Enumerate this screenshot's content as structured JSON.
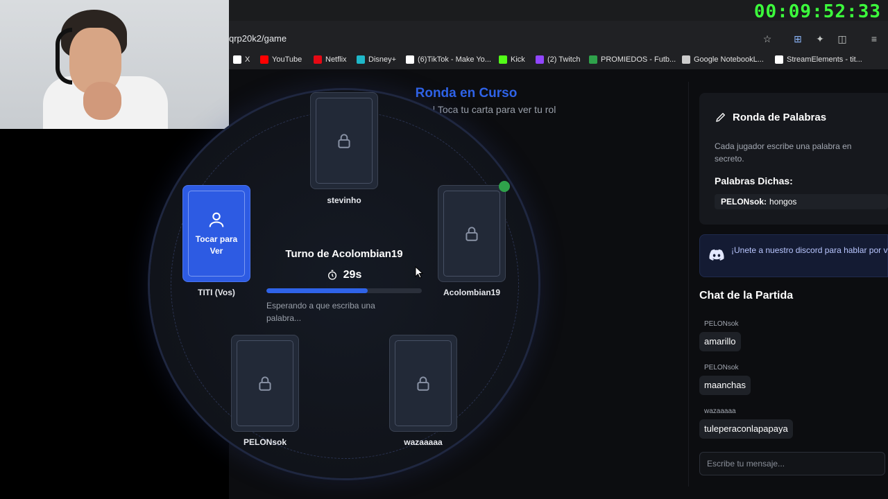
{
  "browser": {
    "url": "qrp20k2/game",
    "bookmarks": [
      {
        "label": "X",
        "icon": "x-icon",
        "color": "#ffffff"
      },
      {
        "label": "YouTube",
        "icon": "youtube-icon",
        "color": "#ff0000"
      },
      {
        "label": "Netflix",
        "icon": "netflix-icon",
        "color": "#e50914"
      },
      {
        "label": "Disney+",
        "icon": "disney-icon",
        "color": "#1fb8c9"
      },
      {
        "label": "(6)TikTok - Make Yo...",
        "icon": "tiktok-icon",
        "color": "#ffffff"
      },
      {
        "label": "Kick",
        "icon": "kick-icon",
        "color": "#53fc18"
      },
      {
        "label": "(2) Twitch",
        "icon": "twitch-icon",
        "color": "#9146ff"
      },
      {
        "label": "PROMIEDOS - Futb...",
        "icon": "promiedos-icon",
        "color": "#2fa24b"
      },
      {
        "label": "Google NotebookL...",
        "icon": "notebooklm-icon",
        "color": "#cccccc"
      },
      {
        "label": "StreamElements - tit...",
        "icon": "streamelements-icon",
        "color": "#ffffff"
      }
    ]
  },
  "stream_timer": "00:09:52:33",
  "game": {
    "title": "Ronda en Curso",
    "subtitle": "5 Jugadores | Toca tu carta para ver tu rol",
    "my_card_label": "Tocar para Ver",
    "players": {
      "top": "stevinho",
      "left": "TITI (Vos)",
      "right": "Acolombian19",
      "bottom_left": "PELONsok",
      "bottom_right": "wazaaaaa"
    },
    "turn_text": "Turno de Acolombian19",
    "seconds": "29s",
    "timer_fraction": 0.65,
    "waiting_text": "Esperando a que escriba una palabra..."
  },
  "words_panel": {
    "title": "Ronda de Palabras",
    "description": "Cada jugador escribe una palabra en secreto.",
    "said_heading": "Palabras Dichas:",
    "said": [
      {
        "user": "PELONsok:",
        "word": "hongos"
      }
    ]
  },
  "discord_banner": "¡Unete a nuestro discord para hablar por voz!",
  "chat": {
    "title": "Chat de la Partida",
    "messages": [
      {
        "user": "PELONsok",
        "text": "amarillo"
      },
      {
        "user": "PELONsok",
        "text": "maanchas"
      },
      {
        "user": "wazaaaaa",
        "text": "tuleperaconlapapaya"
      }
    ],
    "placeholder": "Escribe tu mensaje..."
  },
  "colors": {
    "accent": "#2f63e8",
    "timer": "#3cff3c",
    "ready": "#2fa24b"
  }
}
